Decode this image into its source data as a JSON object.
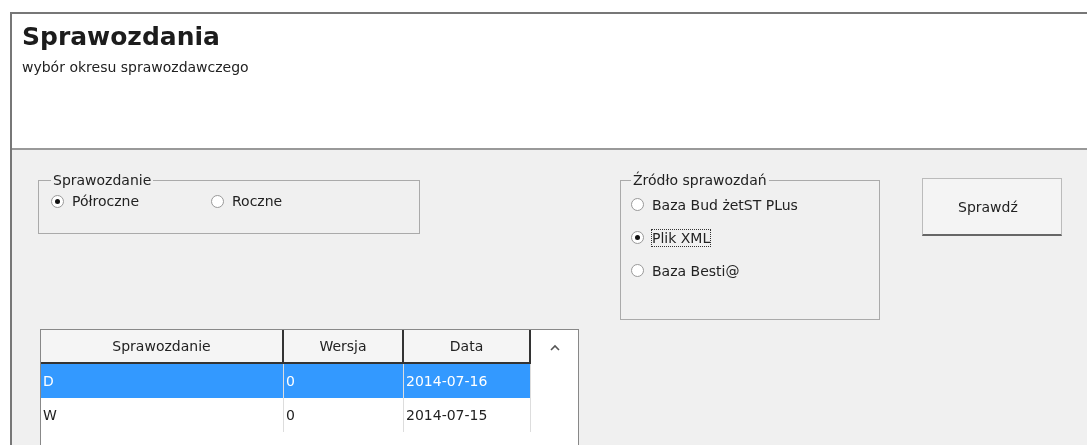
{
  "header": {
    "title": "Sprawozdania",
    "subtitle": "wybór okresu sprawozdawczego"
  },
  "report_group": {
    "legend": "Sprawozdanie",
    "options": [
      {
        "label": "Półroczne",
        "selected": true
      },
      {
        "label": "Roczne",
        "selected": false
      }
    ]
  },
  "source_group": {
    "legend": "Źródło sprawozdań",
    "options": [
      {
        "label": "Baza Bud żetST PLus",
        "selected": false
      },
      {
        "label": "Plik XML",
        "selected": true
      },
      {
        "label": "Baza Besti@",
        "selected": false
      }
    ]
  },
  "check_button": "Sprawdź",
  "table": {
    "columns": [
      "Sprawozdanie",
      "Wersja",
      "Data"
    ],
    "rows": [
      {
        "cells": [
          "D",
          "0",
          "2014-07-16"
        ],
        "selected": true
      },
      {
        "cells": [
          "W",
          "0",
          "2014-07-15"
        ],
        "selected": false
      }
    ]
  }
}
